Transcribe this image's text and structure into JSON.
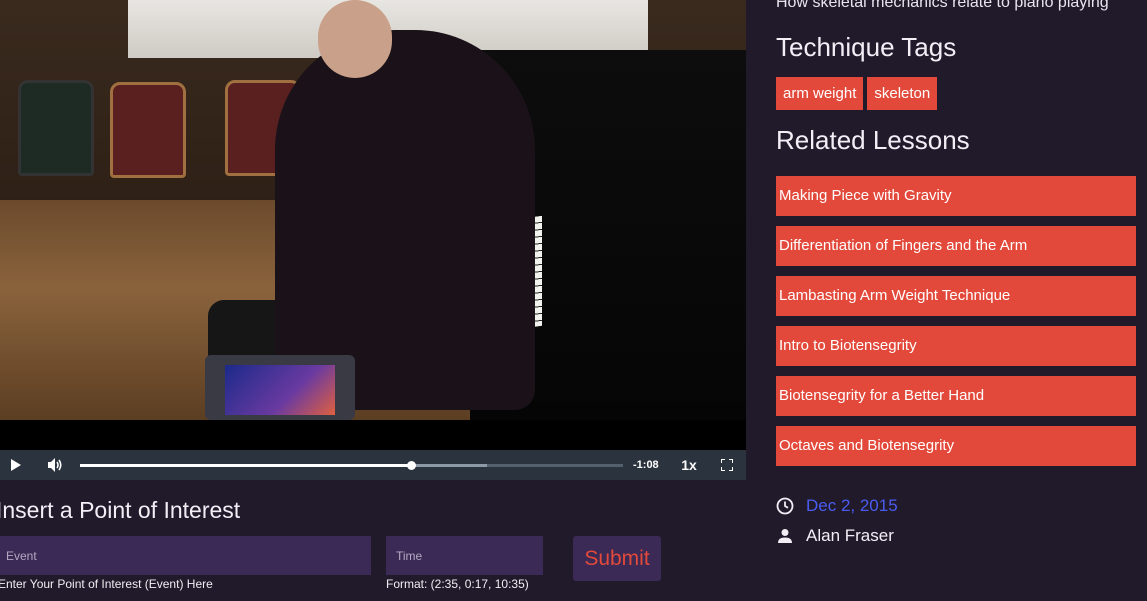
{
  "player": {
    "time_remaining": "-1:08",
    "playback_rate": "1x",
    "played_fraction": 0.61,
    "buffered_fraction": 0.75
  },
  "poi_form": {
    "title": "Insert a Point of Interest",
    "event_placeholder": "Event",
    "time_placeholder": "Time",
    "event_hint": "Enter Your Point of Interest (Event) Here",
    "time_hint": "Format: (2:35, 0:17, 10:35)",
    "submit_label": "Submit"
  },
  "sidebar": {
    "description": "How skeletal mechanics relate to piano playing",
    "tags_heading": "Technique Tags",
    "tags": [
      "arm weight",
      "skeleton"
    ],
    "related_heading": "Related Lessons",
    "related_lessons": [
      "Making Piece with Gravity",
      "Differentiation of Fingers and the Arm",
      "Lambasting Arm Weight Technique",
      "Intro to Biotensegrity",
      "Biotensegrity for a Better Hand",
      "Octaves and Biotensegrity"
    ],
    "date": "Dec 2, 2015",
    "author": "Alan Fraser"
  },
  "colors": {
    "background": "#211a2b",
    "accent": "#e2493b",
    "field_bg": "#3b2a55",
    "link": "#4a5cf0"
  },
  "icons": {
    "play": "play-icon",
    "volume": "volume-icon",
    "fullscreen": "fullscreen-icon",
    "clock": "clock-icon",
    "user": "user-icon"
  }
}
